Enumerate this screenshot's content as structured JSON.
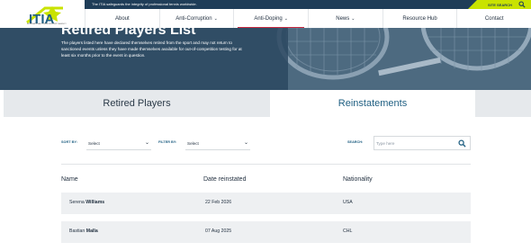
{
  "header": {
    "logo_text": "ITIA",
    "logo_subtitle": "INTERNATIONAL TENNIS INTEGRITY AGENCY",
    "tagline": "The ITIA safeguards the integrity of professional tennis worldwide.",
    "site_search_label": "SITE SEARCH",
    "nav": [
      {
        "label": "About",
        "has_dropdown": false
      },
      {
        "label": "Anti-Corruption",
        "has_dropdown": true
      },
      {
        "label": "Anti-Doping",
        "has_dropdown": true,
        "active": true
      },
      {
        "label": "News",
        "has_dropdown": true
      },
      {
        "label": "Resource Hub",
        "has_dropdown": false
      },
      {
        "label": "Contact",
        "has_dropdown": false
      }
    ],
    "caret": "⌄"
  },
  "hero": {
    "title": "Retired Players List",
    "description": "The players listed here have declared themselves retired from the sport and may not return to sanctioned events unless they have made themselves available for out-of-competition testing for at least six months prior to the event in question."
  },
  "tabs": [
    {
      "label": "Retired Players",
      "active": false
    },
    {
      "label": "Reinstatements",
      "active": true
    }
  ],
  "filters": {
    "sort_label": "SORT BY:",
    "sort_value": "Select",
    "filter_label": "FILTER BY:",
    "filter_value": "Select",
    "search_label": "SEARCH:",
    "search_placeholder": "Type here"
  },
  "table": {
    "columns": [
      "Name",
      "Date reinstated",
      "Nationality"
    ],
    "rows": [
      {
        "first": "Serena",
        "last": "Williams",
        "date": "22 Feb 2026",
        "nationality": "USA"
      },
      {
        "first": "Bastian",
        "last": "Malla",
        "date": "07 Aug 2025",
        "nationality": "CHL"
      }
    ]
  },
  "colors": {
    "navy": "#1f3d58",
    "accent_lime": "#c9e300",
    "active_underline": "#c9283f",
    "link_blue": "#1f5f82",
    "tab_inactive_bg": "#e6e9ec"
  }
}
